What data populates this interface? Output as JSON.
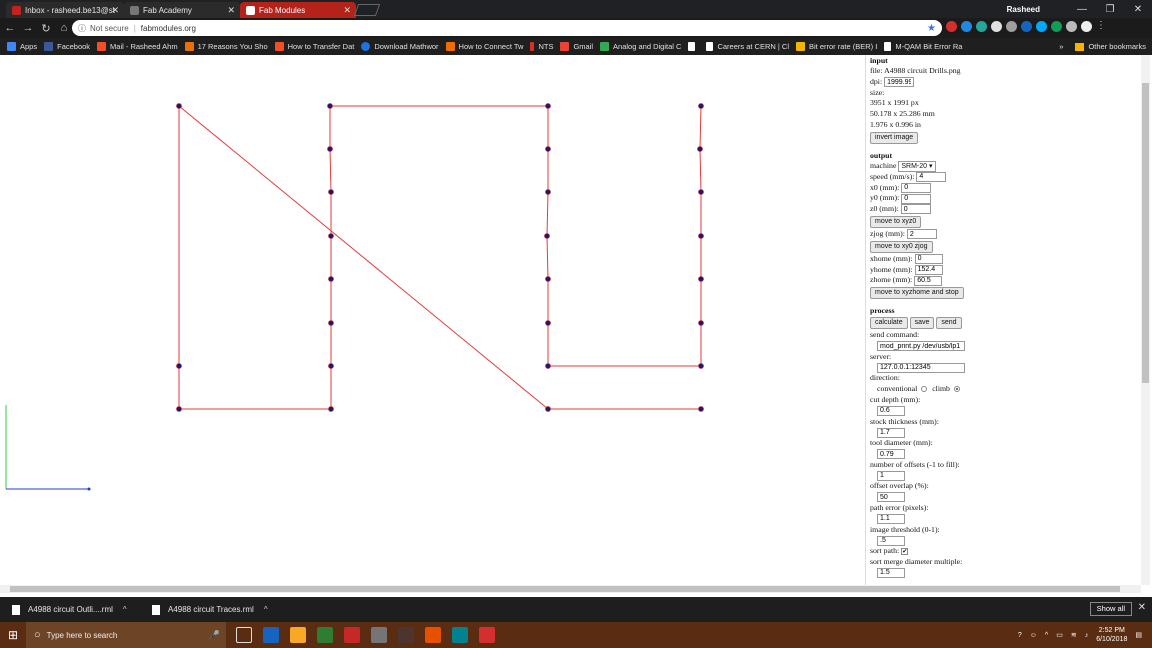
{
  "browser": {
    "tabs": [
      {
        "title": "Inbox - rasheed.be13@st",
        "color": "#c5221f"
      },
      {
        "title": "Fab Academy",
        "color": "#3a3a3a"
      },
      {
        "title": "Fab Modules",
        "color": "#b3231a"
      }
    ],
    "user": "Rasheed",
    "security_label": "Not secure",
    "url": "fabmodules.org"
  },
  "bookmarks": [
    {
      "label": "Apps",
      "color": "#4285f4"
    },
    {
      "label": "Facebook",
      "color": "#3b5998"
    },
    {
      "label": "Mail - Rasheed Ahm",
      "color": "#f25022"
    },
    {
      "label": "17 Reasons You Sho",
      "color": "#e8710a"
    },
    {
      "label": "How to Transfer Dat",
      "color": "#f25022"
    },
    {
      "label": "Download Mathwor",
      "color": "#1a73e8"
    },
    {
      "label": "How to Connect Tw",
      "color": "#ef6c00"
    },
    {
      "label": "NTS",
      "color": "#d93025"
    },
    {
      "label": "Gmail",
      "color": "#ea4335"
    },
    {
      "label": "Analog and Digital C",
      "color": "#34a853"
    },
    {
      "label": "",
      "color": "#ffffff"
    },
    {
      "label": "Careers at CERN | Cl",
      "color": "#ffffff"
    },
    {
      "label": "Bit error rate (BER) I",
      "color": "#f4b400"
    },
    {
      "label": "M-QAM Bit Error Ra",
      "color": "#ffffff"
    }
  ],
  "bookmarks_more": "»",
  "bookmarks_other": "Other bookmarks",
  "panel": {
    "input_header": "input",
    "file_line": "file: A4988 circuit Drills.png",
    "dpi_label": "dpi:",
    "dpi_value": "1999.99",
    "size_label": "size:",
    "size_px": "3951 x 1991 px",
    "size_mm": "50.178 x 25.286 mm",
    "size_in": "1.976 x 0.996 in",
    "invert_button": "invert image",
    "output_header": "output",
    "machine_label": "machine",
    "machine_value": "SRM-20 ▾",
    "speed_label": "speed (mm/s):",
    "speed_value": "4",
    "x0_label": "x0 (mm):",
    "x0_value": "0",
    "y0_label": "y0 (mm):",
    "y0_value": "0",
    "z0_label": "z0 (mm):",
    "z0_value": "0",
    "move_xyz0_button": "move to xyz0",
    "zjog_label": "zjog (mm):",
    "zjog_value": "2",
    "move_xy0zjog_button": "move to xy0 zjog",
    "xhome_label": "xhome (mm):",
    "xhome_value": "0",
    "yhome_label": "yhome (mm):",
    "yhome_value": "152.4",
    "zhome_label": "zhome (mm):",
    "zhome_value": "60.5",
    "move_home_button": "move to xyzhome and stop",
    "process_header": "process",
    "calculate_button": "calculate",
    "save_button": "save",
    "send_button": "send",
    "send_command_label": "send command:",
    "send_command_value": "mod_print.py /dev/usb/lp1 ';",
    "server_label": "server:",
    "server_value": "127.0.0.1:12345",
    "direction_label": "direction:",
    "conventional_label": "conventional",
    "climb_label": "climb",
    "cut_depth_label": "cut depth (mm):",
    "cut_depth_value": "0.6",
    "stock_label": "stock thickness (mm):",
    "stock_value": "1.7",
    "tool_label": "tool diameter (mm):",
    "tool_value": "0.79",
    "offsets_label": "number of offsets (-1 to fill):",
    "offsets_value": "1",
    "overlap_label": "offset overlap (%):",
    "overlap_value": "50",
    "path_error_label": "path error (pixels):",
    "path_error_value": "1.1",
    "threshold_label": "image threshold (0-1):",
    "threshold_value": ".5",
    "sort_path_label": "sort path:",
    "sort_merge_label": "sort merge diameter multiple:",
    "sort_merge_value": "1.5"
  },
  "downloads": [
    {
      "name": "A4988 circuit Outli....rml"
    },
    {
      "name": "A4988 circuit Traces.rml"
    }
  ],
  "show_all": "Show all",
  "taskbar": {
    "search_placeholder": "Type here to search",
    "time": "2:52 PM",
    "date": "6/10/2018",
    "icon_colors": [
      "#1565c0",
      "#f9a825",
      "#2e7d32",
      "#c62828",
      "#6a1b9a",
      "#4e342e",
      "#e65100",
      "#00838f",
      "#d32f2f"
    ]
  }
}
